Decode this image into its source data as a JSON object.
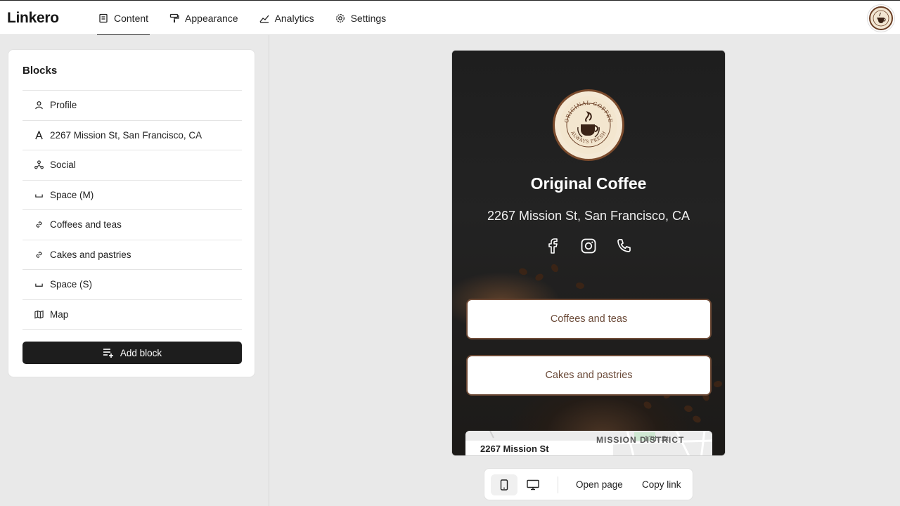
{
  "brand": "Linkero",
  "nav": {
    "tabs": [
      {
        "label": "Content",
        "icon": "content-icon",
        "active": true
      },
      {
        "label": "Appearance",
        "icon": "paint-roller-icon",
        "active": false
      },
      {
        "label": "Analytics",
        "icon": "chart-icon",
        "active": false
      },
      {
        "label": "Settings",
        "icon": "gear-icon",
        "active": false
      }
    ]
  },
  "blocks": {
    "title": "Blocks",
    "items": [
      {
        "label": "Profile",
        "icon": "user-icon"
      },
      {
        "label": "2267 Mission St, San Francisco, CA",
        "icon": "text-icon"
      },
      {
        "label": "Social",
        "icon": "share-nodes-icon"
      },
      {
        "label": "Space (M)",
        "icon": "space-icon"
      },
      {
        "label": "Coffees and teas",
        "icon": "link-icon"
      },
      {
        "label": "Cakes and pastries",
        "icon": "link-icon"
      },
      {
        "label": "Space (S)",
        "icon": "space-icon"
      },
      {
        "label": "Map",
        "icon": "map-icon"
      }
    ],
    "add_label": "Add block"
  },
  "preview": {
    "logo_text_top": "ORIGINAL COFFEE",
    "logo_text_bottom": "ALWAYS FRESH",
    "name": "Original Coffee",
    "address": "2267 Mission St, San Francisco, CA",
    "socials": [
      "facebook-icon",
      "instagram-icon",
      "phone-icon"
    ],
    "links": [
      "Coffees and teas",
      "Cakes and pastries"
    ],
    "map": {
      "address_label": "2267 Mission St",
      "district": "MISSION DISTRICT",
      "street": "17th St"
    },
    "accent_color": "#6d4a36"
  },
  "toolbar": {
    "open_label": "Open page",
    "copy_label": "Copy link"
  }
}
